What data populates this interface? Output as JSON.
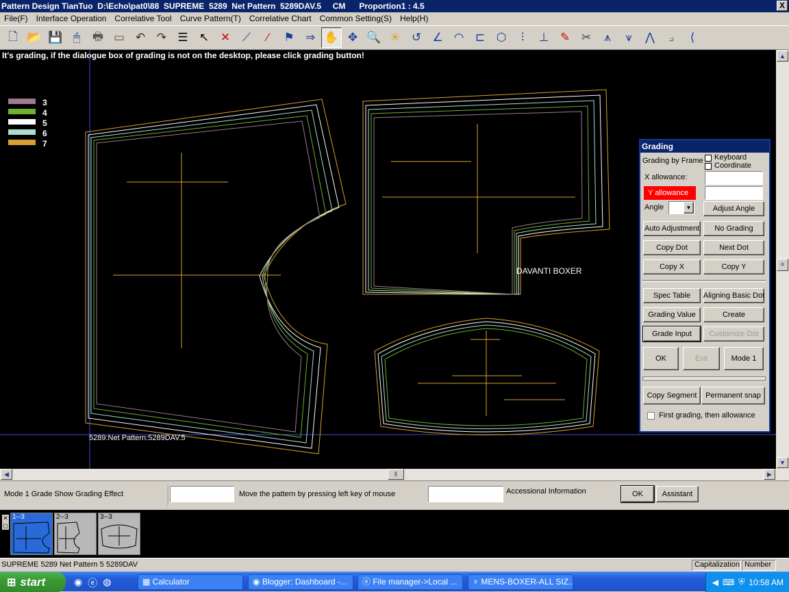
{
  "window": {
    "title": "Pattern Design TianTuo  D:\\Echo\\pat0\\88  SUPREME  5289  Net Pattern  5289DAV.5     CM      Proportion1 : 4.5",
    "close": "X"
  },
  "menu": [
    "File(F)",
    "Interface Operation",
    "Correlative Tool",
    "Curve Pattern(T)",
    "Correlative Chart",
    "Common Setting(S)",
    "Help(H)"
  ],
  "toolbar_icons": [
    "new-file",
    "open-folder",
    "save-disk",
    "mouse",
    "printer",
    "plotter",
    "undo",
    "redo",
    "list",
    "pointer",
    "cross-cut",
    "line-pattern",
    "point-edit",
    "flag",
    "arrow-right",
    "pan-hand",
    "move-cross",
    "zoom",
    "star-point",
    "curve-tool",
    "angle-tool",
    "notch",
    "grade-frame",
    "measure",
    "ruler",
    "pencil",
    "scissors",
    "pant-front",
    "pant-back",
    "zigzag",
    "grade-chart",
    "mirror"
  ],
  "canvas": {
    "notice": "It's grading, if the dialogue box of grading is not on the desktop, please click grading button!",
    "legend": [
      {
        "label": "3",
        "color": "#a07890"
      },
      {
        "label": "4",
        "color": "#70b030"
      },
      {
        "label": "5",
        "color": "#ffffff"
      },
      {
        "label": "6",
        "color": "#a8e0d0"
      },
      {
        "label": "7",
        "color": "#d8a030"
      }
    ],
    "piece_label": "DAVANTI BOXER",
    "pattern_caption": "5289:Net Pattern:5289DAV.5"
  },
  "grading": {
    "title": "Grading",
    "grading_by_frame": "Grading by Frame",
    "keyboard": "Keyboard",
    "coordinate": "Coordinate",
    "x_allowance": "X allowance:",
    "y_allowance": "Y allowance",
    "angle": "Angle",
    "adjust_angle": "Adjust Angle",
    "auto_adjustment": "Auto Adjustment",
    "no_grading": "No Grading",
    "copy_dot": "Copy Dot",
    "next_dot": "Next Dot",
    "copy_x": "Copy  X",
    "copy_y": "Copy  Y",
    "spec_table": "Spec Table",
    "aligning_basic_dot": "Aligning Basic Dot",
    "grading_value": "Grading Value",
    "create": "Create",
    "grade_input": "Grade Input",
    "customize_dot": "Customize Dot",
    "ok": "OK",
    "exit": "Exit",
    "mode1": "Mode 1",
    "copy_segment": "Copy Segment",
    "permanent_snap": "Permanent snap",
    "first_grading": "First grading, then allowance"
  },
  "statusbar": {
    "mode": "Mode 1 Grade  Show Grading Effect",
    "hint": "Move the pattern by pressing left key of mouse",
    "accessional": "Accessional Information",
    "ok": "OK",
    "assistant": "Assistant"
  },
  "thumbnails": [
    "1--3",
    "2--3",
    "3--3"
  ],
  "bottom_status": {
    "left": "SUPREME  5289  Net Pattern  5  5289DAV",
    "caps": "Capitalization",
    "num": "Number"
  },
  "taskbar": {
    "start": "start",
    "tasks": [
      "Calculator",
      "Blogger: Dashboard -...",
      "File manager->Local ...",
      "MENS-BOXER-ALL SIZ..."
    ],
    "clock": "10:58 AM"
  }
}
